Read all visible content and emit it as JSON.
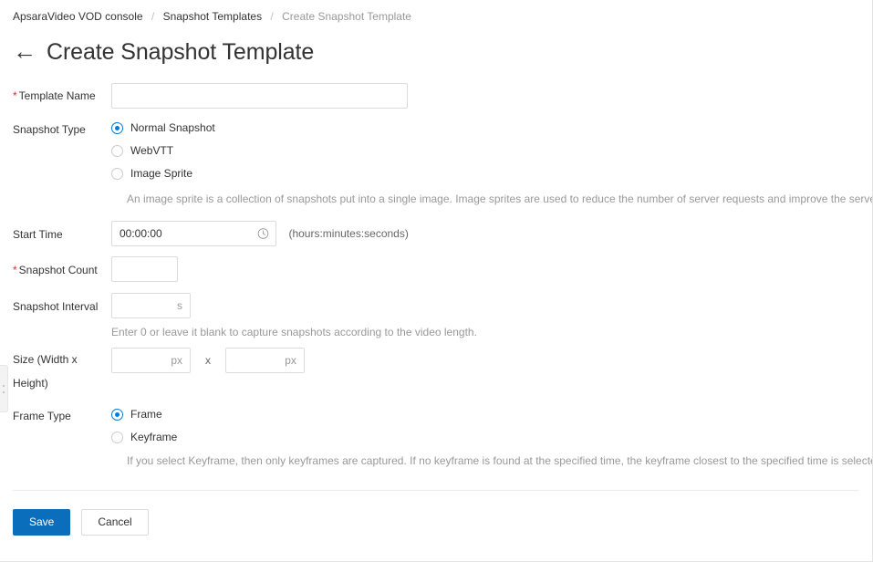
{
  "breadcrumb": {
    "items": [
      {
        "label": "ApsaraVideo VOD console",
        "current": false
      },
      {
        "label": "Snapshot Templates",
        "current": false
      },
      {
        "label": "Create Snapshot Template",
        "current": true
      }
    ],
    "separator": "/"
  },
  "header": {
    "back_icon": "arrow-left-icon",
    "title": "Create Snapshot Template"
  },
  "form": {
    "template_name": {
      "label": "Template Name",
      "required_marker": "*",
      "value": "",
      "placeholder": ""
    },
    "snapshot_type": {
      "label": "Snapshot Type",
      "selected": "Normal Snapshot",
      "options": [
        {
          "label": "Normal Snapshot",
          "checked": true
        },
        {
          "label": "WebVTT",
          "checked": false
        },
        {
          "label": "Image Sprite",
          "checked": false
        }
      ],
      "hint": "An image sprite is a collection of snapshots put into a single image. Image sprites are used to reduce the number of server requests and improve the server performance."
    },
    "start_time": {
      "label": "Start Time",
      "value": "00:00:00",
      "icon": "clock-icon",
      "hint": "(hours:minutes:seconds)"
    },
    "snapshot_count": {
      "label": "Snapshot Count",
      "required_marker": "*",
      "value": "",
      "placeholder": ""
    },
    "snapshot_interval": {
      "label": "Snapshot Interval",
      "value": "",
      "suffix": "s",
      "hint": "Enter 0 or leave it blank to capture snapshots according to the video length."
    },
    "size": {
      "label": "Size (Width x Height)",
      "width": {
        "value": "",
        "suffix": "px"
      },
      "separator": "x",
      "height": {
        "value": "",
        "suffix": "px"
      }
    },
    "frame_type": {
      "label": "Frame Type",
      "selected": "Frame",
      "options": [
        {
          "label": "Frame",
          "checked": true
        },
        {
          "label": "Keyframe",
          "checked": false
        }
      ],
      "hint": "If you select Keyframe, then only keyframes are captured. If no keyframe is found at the specified time, the keyframe closest to the specified time is selected. It is much faste"
    }
  },
  "footer": {
    "save_label": "Save",
    "cancel_label": "Cancel"
  },
  "colors": {
    "primary": "#0a6ebd",
    "accent": "#0a7ad1",
    "required": "#d93026",
    "text": "#333333",
    "muted": "#999999",
    "border": "#dcdcdc"
  }
}
